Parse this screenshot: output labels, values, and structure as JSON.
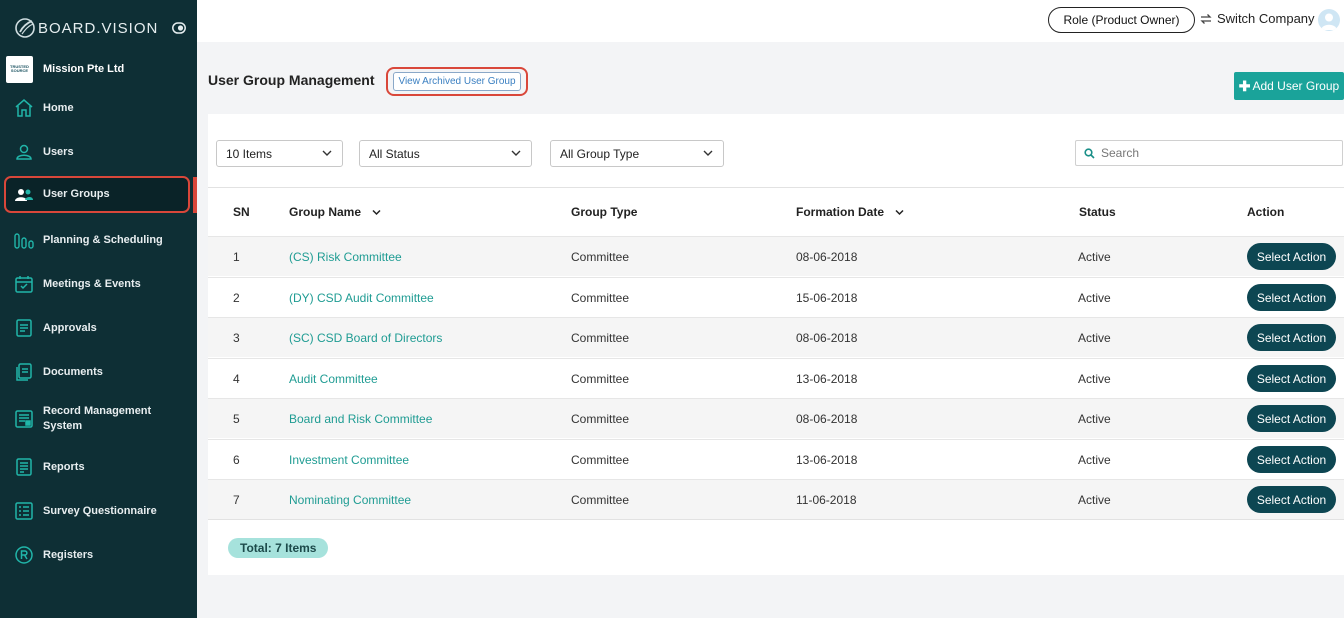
{
  "brand": {
    "name": "BOARD.VISION"
  },
  "company": {
    "logo_text": "TRUSTED SOURCE",
    "name": "Mission Pte Ltd"
  },
  "sidebar": {
    "items": [
      {
        "label": "Home",
        "icon": "home-icon"
      },
      {
        "label": "Users",
        "icon": "user-icon"
      },
      {
        "label": "User Groups",
        "icon": "user-group-icon",
        "active": true
      },
      {
        "label": "Planning & Scheduling",
        "icon": "planning-icon"
      },
      {
        "label": "Meetings & Events",
        "icon": "calendar-icon"
      },
      {
        "label": "Approvals",
        "icon": "approvals-icon"
      },
      {
        "label": "Documents",
        "icon": "documents-icon"
      },
      {
        "label": "Record Management System",
        "icon": "records-icon"
      },
      {
        "label": "Reports",
        "icon": "reports-icon"
      },
      {
        "label": "Survey Questionnaire",
        "icon": "survey-icon"
      },
      {
        "label": "Registers",
        "icon": "registered-icon"
      }
    ]
  },
  "topbar": {
    "role_label": "Role (Product Owner)",
    "switch_label": "Switch Company"
  },
  "page": {
    "title": "User Group Management",
    "archived_label": "View Archived User Group",
    "add_label": "Add User Group"
  },
  "filters": {
    "items_per_page": "10 Items",
    "status": "All Status",
    "group_type": "All Group Type",
    "search_placeholder": "Search"
  },
  "table": {
    "columns": [
      "SN",
      "Group Name",
      "Group Type",
      "Formation Date",
      "Status",
      "Action"
    ],
    "rows": [
      {
        "sn": "1",
        "name": "(CS) Risk Committee",
        "type": "Committee",
        "date": "08-06-2018",
        "status": "Active",
        "action": "Select Action"
      },
      {
        "sn": "2",
        "name": "(DY) CSD Audit Committee",
        "type": "Committee",
        "date": "15-06-2018",
        "status": "Active",
        "action": "Select Action"
      },
      {
        "sn": "3",
        "name": "(SC) CSD Board of Directors",
        "type": "Committee",
        "date": "08-06-2018",
        "status": "Active",
        "action": "Select Action"
      },
      {
        "sn": "4",
        "name": "Audit Committee",
        "type": "Committee",
        "date": "13-06-2018",
        "status": "Active",
        "action": "Select Action"
      },
      {
        "sn": "5",
        "name": "Board and Risk Committee",
        "type": "Committee",
        "date": "08-06-2018",
        "status": "Active",
        "action": "Select Action"
      },
      {
        "sn": "6",
        "name": "Investment Committee",
        "type": "Committee",
        "date": "13-06-2018",
        "status": "Active",
        "action": "Select Action"
      },
      {
        "sn": "7",
        "name": "Nominating Committee",
        "type": "Committee",
        "date": "11-06-2018",
        "status": "Active",
        "action": "Select Action"
      }
    ],
    "total": "Total: 7 Items"
  },
  "colors": {
    "sidebar_bg": "#0e2f35",
    "accent_teal": "#1aa39a",
    "action_button": "#0d4652",
    "highlight_red": "#d9473a"
  }
}
